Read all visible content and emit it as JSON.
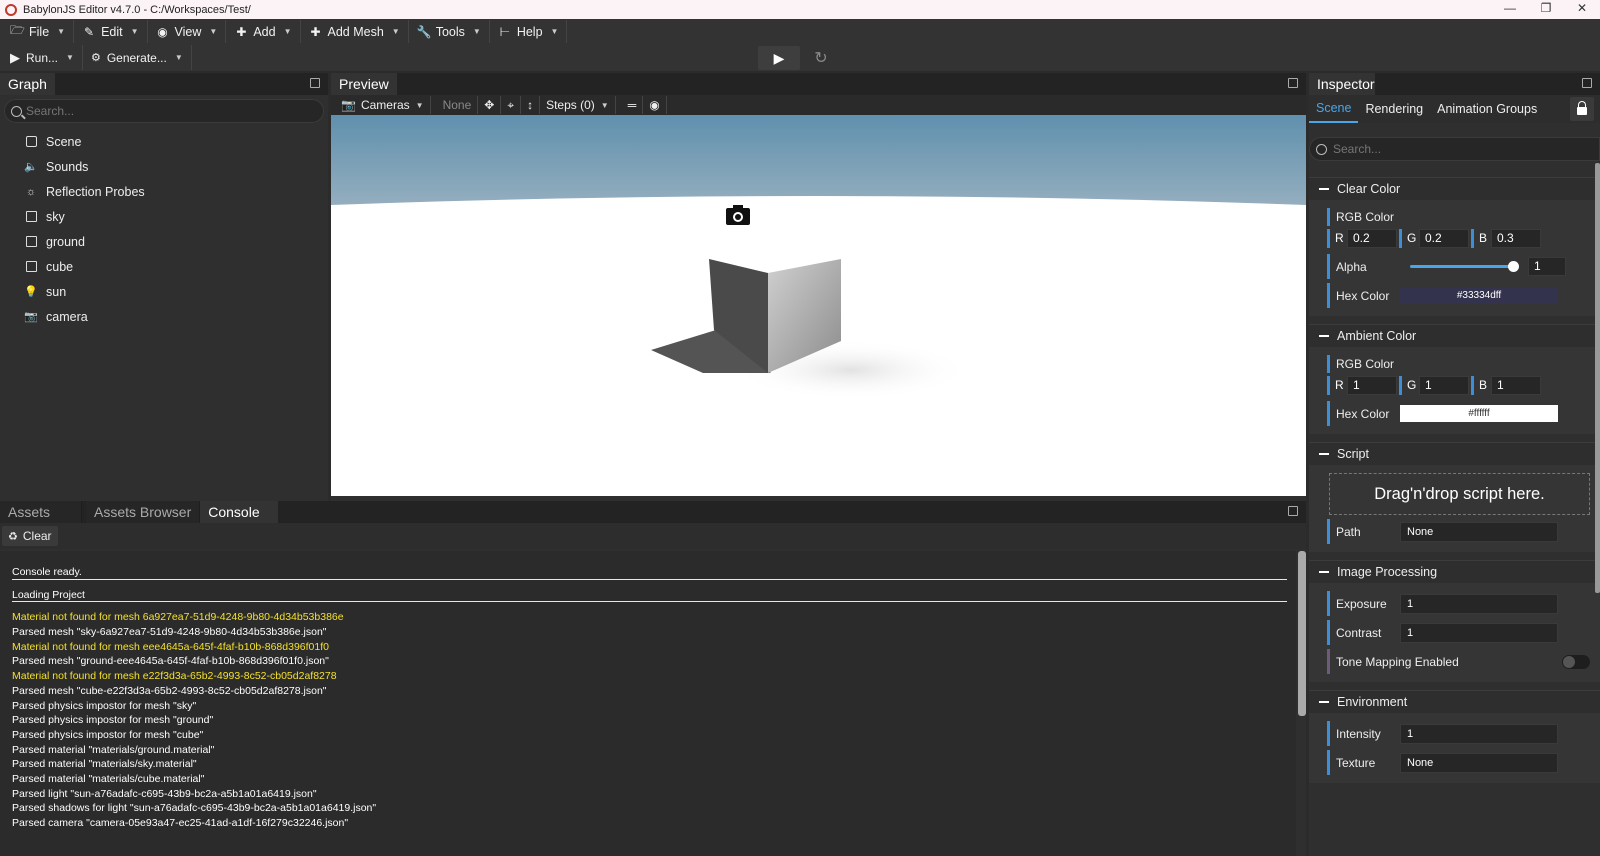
{
  "window": {
    "title": "BabylonJS Editor v4.7.0 - C:/Workspaces/Test/",
    "controls": [
      "minimize-icon",
      "restore-icon",
      "close-icon"
    ]
  },
  "menubar": {
    "items": [
      {
        "label": "File",
        "icon": "folder-icon"
      },
      {
        "label": "Edit",
        "icon": "edit-icon"
      },
      {
        "label": "View",
        "icon": "eye-icon"
      },
      {
        "label": "Add",
        "icon": "plus-icon"
      },
      {
        "label": "Add Mesh",
        "icon": "plus-icon"
      },
      {
        "label": "Tools",
        "icon": "wrench-icon"
      },
      {
        "label": "Help",
        "icon": "sitemap-icon"
      }
    ]
  },
  "toolbar": {
    "run_label": "Run...",
    "generate_label": "Generate..."
  },
  "graph": {
    "title": "Graph",
    "search_placeholder": "Search...",
    "items": [
      {
        "label": "Scene",
        "icon": "scene-icon"
      },
      {
        "label": "Sounds",
        "icon": "speaker-icon"
      },
      {
        "label": "Reflection Probes",
        "icon": "probe-icon"
      },
      {
        "label": "sky",
        "icon": "mesh-icon"
      },
      {
        "label": "ground",
        "icon": "mesh-icon"
      },
      {
        "label": "cube",
        "icon": "mesh-icon"
      },
      {
        "label": "sun",
        "icon": "lightbulb-icon"
      },
      {
        "label": "camera",
        "icon": "camera-icon"
      }
    ]
  },
  "preview": {
    "title": "Preview",
    "cameras_label": "Cameras",
    "none_label": "None",
    "steps_label": "Steps (0)"
  },
  "bottom": {
    "tabs": [
      "Assets",
      "Assets Browser",
      "Console"
    ],
    "active_tab": "Console",
    "clear_label": "Clear",
    "console_ready": "Console ready.",
    "loading": "Loading Project",
    "logs": [
      {
        "text": "Material not found for mesh 6a927ea7-51d9-4248-9b80-4d34b53b386e",
        "level": "warn"
      },
      {
        "text": "Parsed mesh \"sky-6a927ea7-51d9-4248-9b80-4d34b53b386e.json\"",
        "level": "info"
      },
      {
        "text": "Material not found for mesh eee4645a-645f-4faf-b10b-868d396f01f0",
        "level": "warn"
      },
      {
        "text": "Parsed mesh \"ground-eee4645a-645f-4faf-b10b-868d396f01f0.json\"",
        "level": "info"
      },
      {
        "text": "Material not found for mesh e22f3d3a-65b2-4993-8c52-cb05d2af8278",
        "level": "warn"
      },
      {
        "text": "Parsed mesh \"cube-e22f3d3a-65b2-4993-8c52-cb05d2af8278.json\"",
        "level": "info"
      },
      {
        "text": "Parsed physics impostor for mesh \"sky\"",
        "level": "info"
      },
      {
        "text": "Parsed physics impostor for mesh \"ground\"",
        "level": "info"
      },
      {
        "text": "Parsed physics impostor for mesh \"cube\"",
        "level": "info"
      },
      {
        "text": "Parsed material \"materials/ground.material\"",
        "level": "info"
      },
      {
        "text": "Parsed material \"materials/sky.material\"",
        "level": "info"
      },
      {
        "text": "Parsed material \"materials/cube.material\"",
        "level": "info"
      },
      {
        "text": "Parsed light \"sun-a76adafc-c695-43b9-bc2a-a5b1a01a6419.json\"",
        "level": "info"
      },
      {
        "text": "Parsed shadows for light \"sun-a76adafc-c695-43b9-bc2a-a5b1a01a6419.json\"",
        "level": "info"
      },
      {
        "text": "Parsed camera \"camera-05e93a47-ec25-41ad-a1df-16f279c32246.json\"",
        "level": "info"
      }
    ]
  },
  "inspector": {
    "title": "Inspector",
    "tabs": [
      "Scene",
      "Rendering",
      "Animation Groups"
    ],
    "search_placeholder": "Search...",
    "clear_color": {
      "title": "Clear Color",
      "rgb_label": "RGB Color",
      "r": "0.2",
      "g": "0.2",
      "b": "0.3",
      "alpha_label": "Alpha",
      "alpha": "1",
      "hex_label": "Hex Color",
      "hex": "#33334dff"
    },
    "ambient_color": {
      "title": "Ambient Color",
      "rgb_label": "RGB Color",
      "r": "1",
      "g": "1",
      "b": "1",
      "hex_label": "Hex Color",
      "hex": "#ffffff"
    },
    "script": {
      "title": "Script",
      "drop_text": "Drag'n'drop script here.",
      "path_label": "Path",
      "path": "None"
    },
    "image_processing": {
      "title": "Image Processing",
      "exposure_label": "Exposure",
      "exposure": "1",
      "contrast_label": "Contrast",
      "contrast": "1",
      "tone_label": "Tone Mapping Enabled"
    },
    "environment": {
      "title": "Environment",
      "intensity_label": "Intensity",
      "intensity": "1",
      "texture_label": "Texture",
      "texture": "None"
    }
  },
  "colors": {
    "accent": "#4aa6e8",
    "warning": "#f4e12b",
    "clear_color_swatch": "#33334d",
    "sky_top": "#5f90ad"
  }
}
